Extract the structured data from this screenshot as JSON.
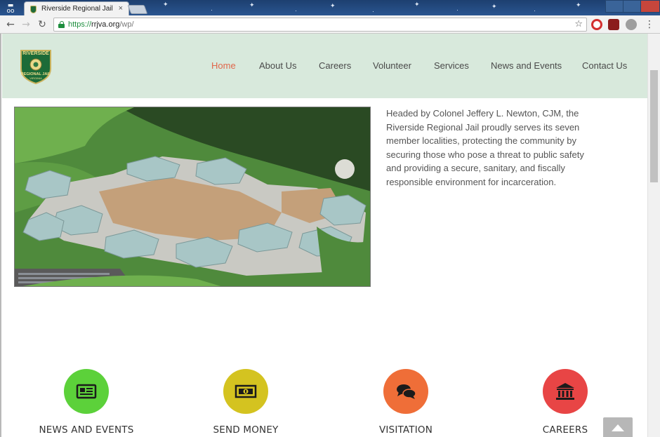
{
  "browser": {
    "tab_title": "Riverside Regional Jail",
    "url_scheme": "https://",
    "url_host": "rrjva.org",
    "url_path": "/wp/"
  },
  "header": {
    "logo_lines": [
      "RIVERSIDE",
      "REGIONAL JAIL",
      "VIRGINIA"
    ],
    "nav": [
      {
        "label": "Home",
        "active": true
      },
      {
        "label": "About Us",
        "active": false
      },
      {
        "label": "Careers",
        "active": false
      },
      {
        "label": "Volunteer",
        "active": false
      },
      {
        "label": "Services",
        "active": false
      },
      {
        "label": "News and Events",
        "active": false
      },
      {
        "label": "Contact Us",
        "active": false
      }
    ]
  },
  "intro": {
    "text": "Headed by Colonel Jeffery L. Newton, CJM, the Riverside Regional Jail proudly serves its seven member localities, protecting the community by securing those who pose a threat to public safety and providing a secure, sanitary, and fiscally responsible environment for incarceration."
  },
  "features": [
    {
      "label": "NEWS AND EVENTS",
      "icon": "newspaper-icon",
      "color": "#5cd13a"
    },
    {
      "label": "SEND MONEY",
      "icon": "money-icon",
      "color": "#d4c320"
    },
    {
      "label": "VISITATION",
      "icon": "chat-bubbles-icon",
      "color": "#ef6e38"
    },
    {
      "label": "CAREERS",
      "icon": "bank-icon",
      "color": "#e84545"
    }
  ],
  "colors": {
    "header_bg": "#d8e9dc",
    "nav_active": "#e0664a",
    "nav_text": "#4a4a4a"
  }
}
